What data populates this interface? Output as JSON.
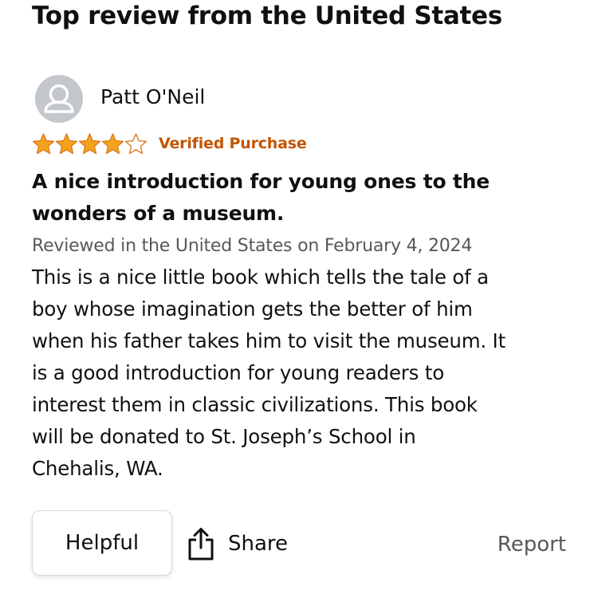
{
  "section": {
    "title": "Top review from the United States"
  },
  "review": {
    "reviewer_name": "Patt O'Neil",
    "avatar_icon": "user-silhouette-icon",
    "rating": 4,
    "max_rating": 5,
    "badge": "Verified Purchase",
    "title_line1": "A nice introduction for young ones to the",
    "title_line2": "wonders of a museum.",
    "date_text": "Reviewed in the United States on February 4, 2024",
    "body_lines": [
      "This is a nice little book which tells the tale of a",
      "boy whose imagination gets the better of him",
      "when his father takes him to visit the museum. It",
      "is a good introduction for young readers to",
      "interest them in classic civilizations. This book",
      "will be donated to St. Joseph’s School in",
      "Chehalis, WA."
    ]
  },
  "actions": {
    "helpful_label": "Helpful",
    "share_label": "Share",
    "share_icon": "share-icon",
    "report_label": "Report"
  },
  "colors": {
    "star_fill": "#f4a41c",
    "star_stroke": "#de7921",
    "verified": "#c45500",
    "muted_text": "#565959",
    "avatar_bg": "#c4c7cc"
  }
}
